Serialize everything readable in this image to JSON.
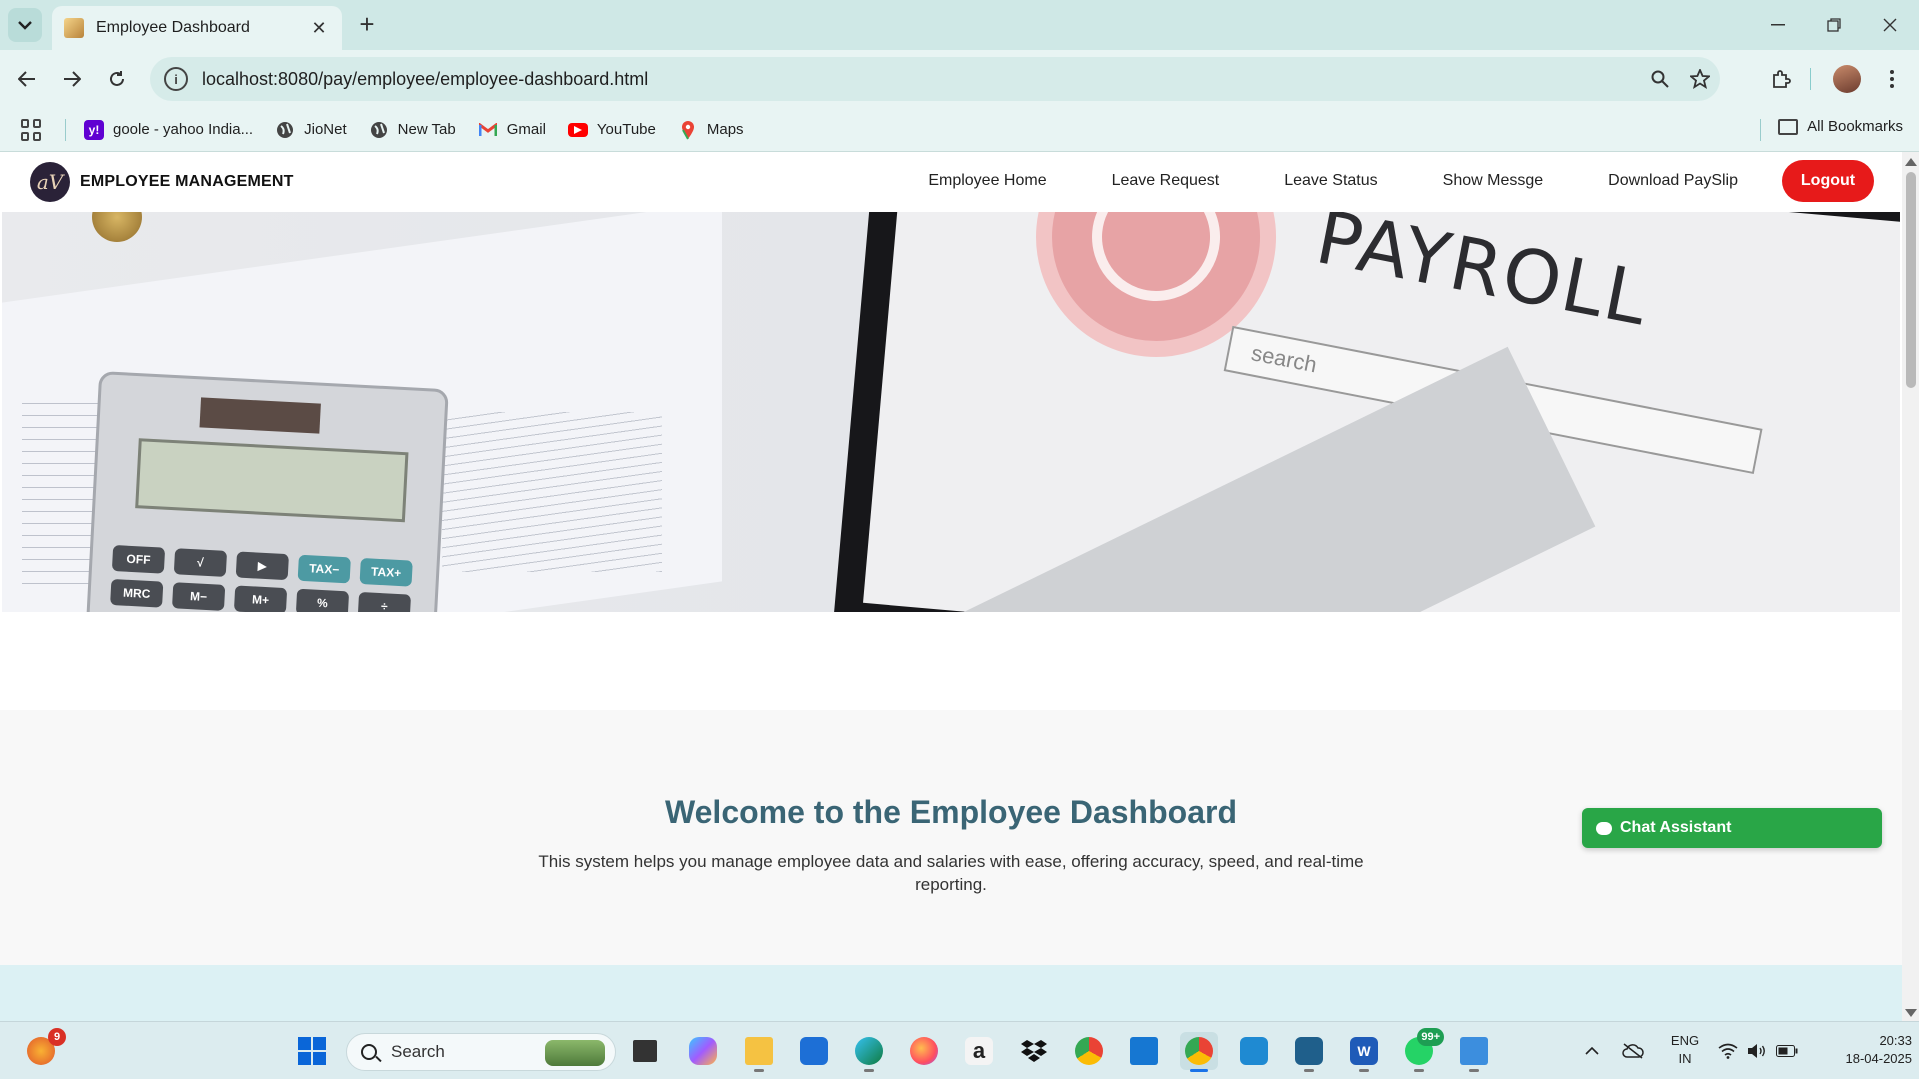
{
  "browser": {
    "tab_title": "Employee Dashboard",
    "url": "localhost:8080/pay/employee/employee-dashboard.html",
    "bookmarks": [
      {
        "label": "goole - yahoo India...",
        "icon": "yahoo-icon",
        "color": "#6001d2"
      },
      {
        "label": "JioNet",
        "icon": "globe-icon",
        "color": "#444444"
      },
      {
        "label": "New Tab",
        "icon": "globe-icon",
        "color": "#444444"
      },
      {
        "label": "Gmail",
        "icon": "gmail-icon",
        "color": "#ea4335"
      },
      {
        "label": "YouTube",
        "icon": "youtube-icon",
        "color": "#ff0000"
      },
      {
        "label": "Maps",
        "icon": "maps-icon",
        "color": "#34a853"
      }
    ],
    "all_bookmarks": "All Bookmarks"
  },
  "site": {
    "logo_text": "aV",
    "brand": "EMPLOYEE MANAGEMENT",
    "nav": {
      "home": "Employee Home",
      "leave_request": "Leave Request",
      "leave_status": "Leave Status",
      "show_message": "Show Messge",
      "download_payslip": "Download PaySlip",
      "logout": "Logout"
    },
    "hero": {
      "payroll_word": "PAYROLL",
      "search_word": "search",
      "calc_keys": [
        "OFF",
        "√",
        "▶",
        "TAX−",
        "TAX+",
        "MRC",
        "M−",
        "M+",
        "%",
        "÷"
      ]
    },
    "welcome": {
      "title": "Welcome to the Employee Dashboard",
      "text": "This system helps you manage employee data and salaries with ease, offering accuracy, speed, and real-time reporting."
    },
    "chat_assistant": "Chat Assistant"
  },
  "taskbar": {
    "search_placeholder": "Search",
    "apps": [
      {
        "name": "weather-app",
        "badge": "9"
      },
      {
        "name": "start-menu"
      },
      {
        "name": "task-view"
      },
      {
        "name": "copilot"
      },
      {
        "name": "file-explorer"
      },
      {
        "name": "microsoft-store"
      },
      {
        "name": "edge"
      },
      {
        "name": "firefox"
      },
      {
        "name": "amazon"
      },
      {
        "name": "dropbox"
      },
      {
        "name": "chrome"
      },
      {
        "name": "remote-desktop"
      },
      {
        "name": "chrome-profile"
      },
      {
        "name": "vscode"
      },
      {
        "name": "mysql-workbench"
      },
      {
        "name": "word"
      },
      {
        "name": "whatsapp",
        "badge": "99+"
      },
      {
        "name": "notepad"
      }
    ],
    "lang_line1": "ENG",
    "lang_line2": "IN",
    "time": "20:33",
    "date": "18-04-2025"
  }
}
